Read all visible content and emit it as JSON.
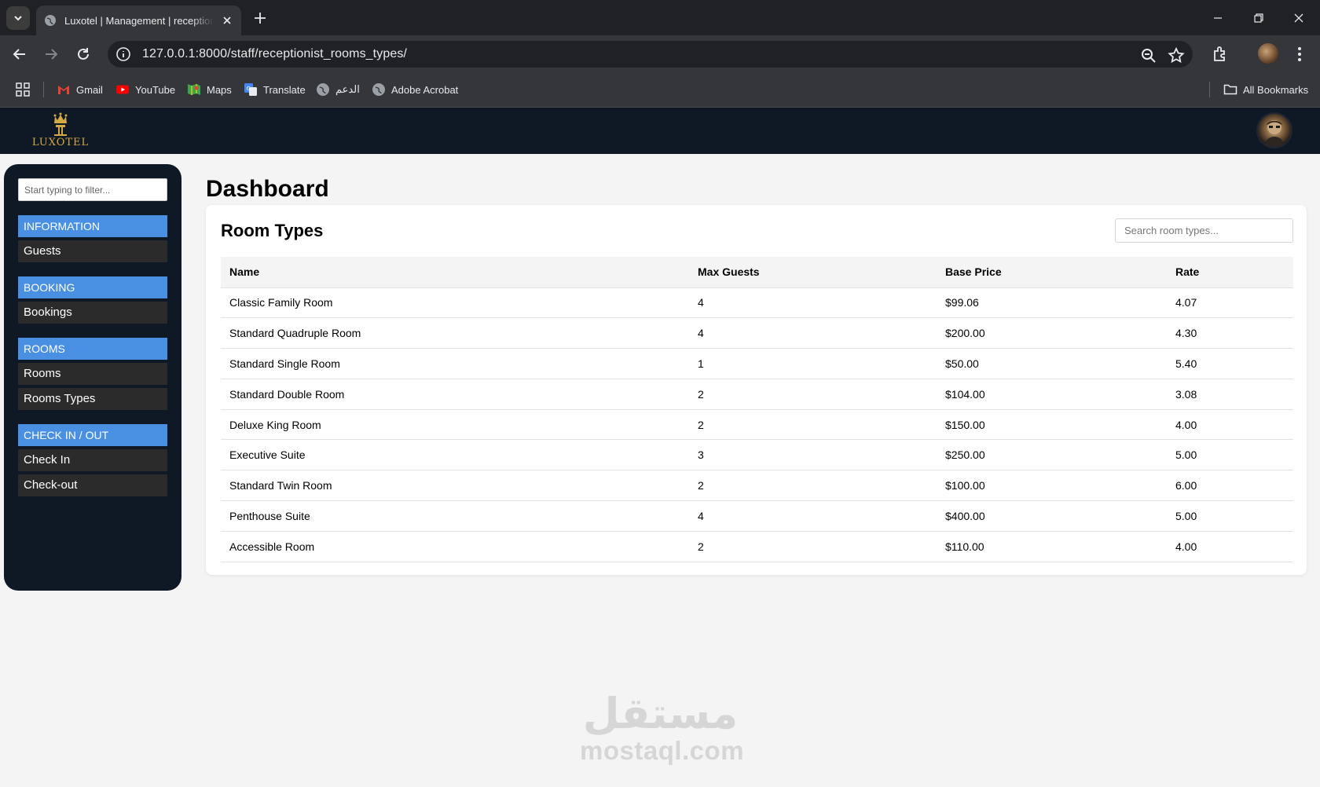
{
  "browser": {
    "tab_title": "Luxotel | Management | receptionist",
    "url": "127.0.0.1:8000/staff/receptionist_rooms_types/",
    "bookmarks": [
      {
        "label": "Gmail",
        "icon": "gmail-icon",
        "color": "#ea4335"
      },
      {
        "label": "YouTube",
        "icon": "youtube-icon",
        "color": "#ff0000"
      },
      {
        "label": "Maps",
        "icon": "maps-icon",
        "color": "#34a853"
      },
      {
        "label": "Translate",
        "icon": "translate-icon",
        "color": "#4285f4"
      },
      {
        "label": "الدعم",
        "icon": "globe-icon",
        "color": "#9aa0a6"
      },
      {
        "label": "Adobe Acrobat",
        "icon": "globe-icon",
        "color": "#9aa0a6"
      }
    ],
    "all_bookmarks_label": "All Bookmarks"
  },
  "app": {
    "brand": "LUXOTEL",
    "brand_color": "#d4a946",
    "header_bg": "#0f1825"
  },
  "sidebar": {
    "filter_placeholder": "Start typing to filter...",
    "accent": "#4a90e2",
    "sections": [
      {
        "title": "INFORMATION",
        "items": [
          "Guests"
        ]
      },
      {
        "title": "BOOKING",
        "items": [
          "Bookings"
        ]
      },
      {
        "title": "ROOMS",
        "items": [
          "Rooms",
          "Rooms Types"
        ]
      },
      {
        "title": "CHECK IN / OUT",
        "items": [
          "Check In",
          "Check-out"
        ]
      }
    ]
  },
  "main": {
    "page_title": "Dashboard",
    "card_title": "Room Types",
    "search_placeholder": "Search room types...",
    "table": {
      "headers": [
        "Name",
        "Max Guests",
        "Base Price",
        "Rate"
      ],
      "rows": [
        [
          "Classic Family Room",
          "4",
          "$99.06",
          "4.07"
        ],
        [
          "Standard Quadruple Room",
          "4",
          "$200.00",
          "4.30"
        ],
        [
          "Standard Single Room",
          "1",
          "$50.00",
          "5.40"
        ],
        [
          "Standard Double Room",
          "2",
          "$104.00",
          "3.08"
        ],
        [
          "Deluxe King Room",
          "2",
          "$150.00",
          "4.00"
        ],
        [
          "Executive Suite",
          "3",
          "$250.00",
          "5.00"
        ],
        [
          "Standard Twin Room",
          "2",
          "$100.00",
          "6.00"
        ],
        [
          "Penthouse Suite",
          "4",
          "$400.00",
          "5.00"
        ],
        [
          "Accessible Room",
          "2",
          "$110.00",
          "4.00"
        ]
      ]
    }
  },
  "watermark": {
    "arabic": "مستقل",
    "latin": "mostaql.com"
  }
}
